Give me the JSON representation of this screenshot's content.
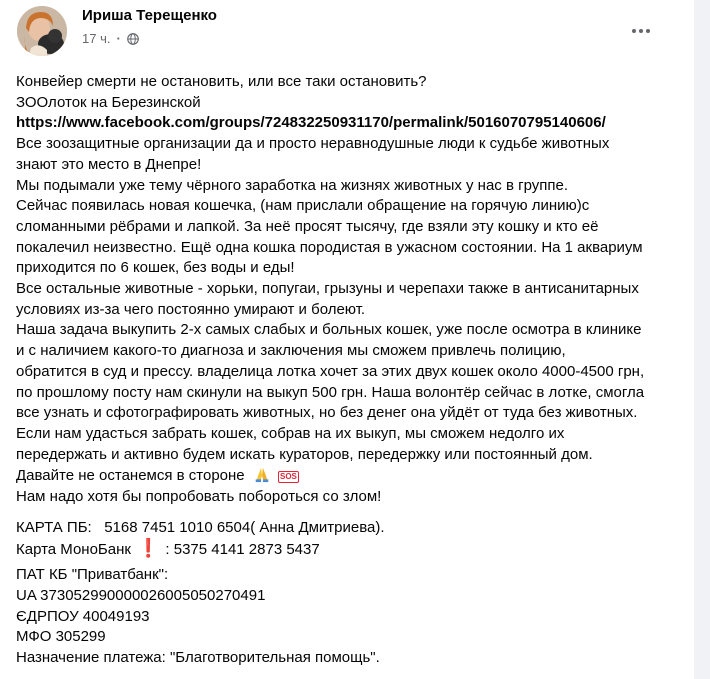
{
  "post": {
    "author": "Ириша Терещенко",
    "time": "17 ч.",
    "separator": "·",
    "audience_icon": "globe-icon",
    "more_icon": "more-options-icon"
  },
  "content": {
    "lines": [
      "Конвейер смерти не остановить, или все таки остановить?",
      "ЗООлоток на Березинской",
      "https://www.facebook.com/groups/724832250931170/permalink/5016070795140606/",
      "Все зоозащитные организации да и просто неравнодушные люди к судьбе животных",
      "знают это место в Днепре!",
      "Мы подымали уже тему чёрного заработка на жизнях животных у нас в группе.",
      "Сейчас появилась новая кошечка, (нам прислали обращение на горячую линию)с",
      "сломанными рёбрами и лапкой. За неё просят тысячу, где взяли эту кошку и кто её",
      "покалечил неизвестно. Ещё одна кошка породистая в ужасном состоянии. На 1 аквариум",
      "приходится по 6 кошек, без воды и еды!",
      "Все остальные животные - хорьки, попугаи, грызуны и черепахи также в антисанитарных",
      "условиях из-за чего постоянно умирают и болеют.",
      "Наша задача выкупить 2-х самых слабых и больных кошек, уже после осмотра в клинике",
      "и с наличием какого-то диагноза и заключения мы сможем привлечь полицию,",
      "обратится в суд и прессу. владелица лотка хочет за этих двух кошек около 4000-4500 грн,",
      "по прошлому посту нам скинули на выкуп 500 грн. Наша волонтёр сейчас в лотке, смогла",
      "все узнать и сфотографировать животных, но без денег она уйдёт от туда без животных.",
      "Если нам удасться забрать кошек, собрав на их выкуп, мы сможем недолго их",
      "передержать и активно будем искать кураторов, передержку или постоянный дом.",
      "Давайте не останемся в стороне",
      "Нам надо хотя бы попробовать побороться со злом!"
    ],
    "sos_label": "SOS",
    "payment": {
      "card_pb_label": "КАРТА ПБ:",
      "card_pb_value": "5168 7451 1010 6504( Анна Дмитриева).",
      "card_mono_label": "Карта МоноБанк",
      "card_mono_value": ": 5375 4141 2873 5437",
      "bank_name": "ПАТ КБ \"Приватбанк\":",
      "iban": "UA 373052990000026005050270491",
      "edrpou": "ЄДРПОУ 40049193",
      "mfo": "МФО 305299",
      "purpose": "Назначение платежа: \"Благотворительная помощь\"."
    }
  }
}
